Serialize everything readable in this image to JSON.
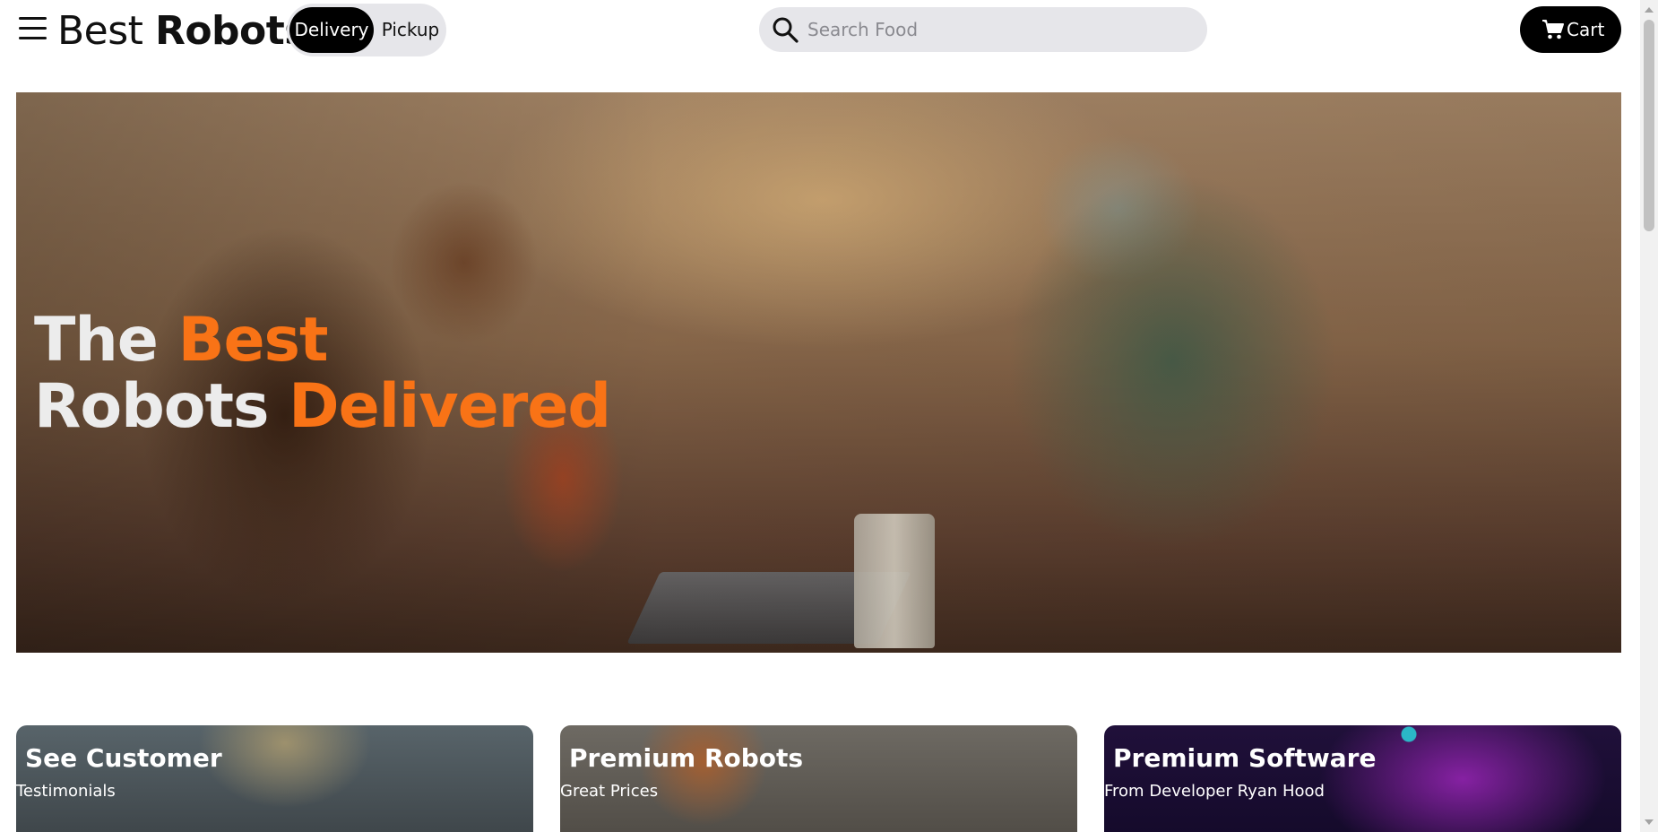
{
  "header": {
    "brand_light": "Best",
    "brand_bold": "Robots",
    "mode_toggle": {
      "delivery_label": "Delivery",
      "pickup_label": "Pickup",
      "selected": "Delivery"
    },
    "search": {
      "placeholder": "Search Food",
      "value": ""
    },
    "cart_label": "Cart",
    "icons": [
      "menu-icon",
      "search-icon",
      "cart-icon"
    ]
  },
  "hero": {
    "line1_white": "The",
    "line1_accent": "Best",
    "line2_white": "Robots",
    "line2_accent": "Delivered"
  },
  "cards": [
    {
      "title": "See Customer",
      "subtitle": "Testimonials"
    },
    {
      "title": "Premium Robots",
      "subtitle": "Great Prices"
    },
    {
      "title": "Premium Software",
      "subtitle": "From Developer Ryan Hood"
    }
  ],
  "colors": {
    "accent": "#f97316",
    "primary_button": "#000000",
    "pill_background": "#e6e6ea",
    "hero_text_white": "#ececec"
  }
}
